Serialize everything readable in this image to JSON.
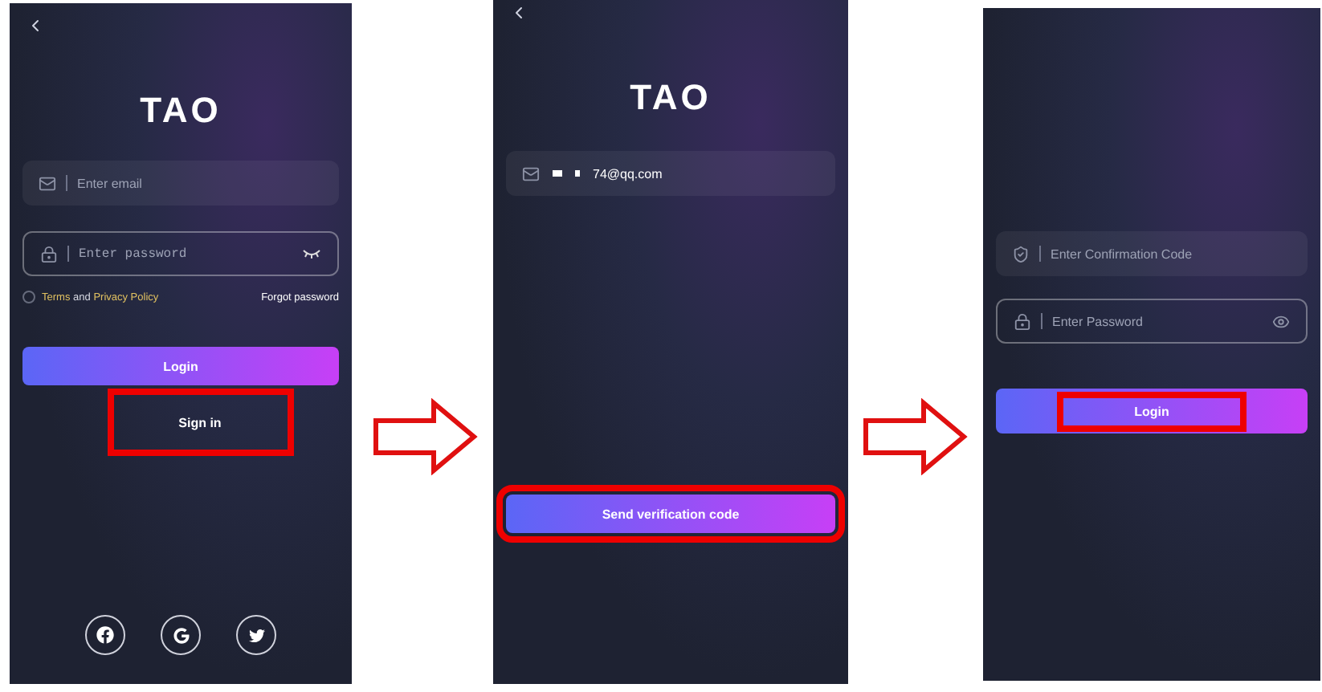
{
  "screens": [
    {
      "kind": "login",
      "logo": "TAO",
      "email_field": {
        "placeholder": "Enter email"
      },
      "password_field": {
        "placeholder": "Enter password"
      },
      "terms": {
        "checked": false,
        "parts": [
          {
            "kind": "link",
            "text": "Terms"
          },
          {
            "kind": "plain",
            "text": "and"
          },
          {
            "kind": "link",
            "text": "Privacy Policy"
          }
        ]
      },
      "forgot_link": "Forgot password",
      "login_button": {
        "label": "Login",
        "highlighted": false
      },
      "sign_in_button": {
        "label": "Sign in",
        "highlighted": true
      },
      "social": [
        {
          "kind": "facebook"
        },
        {
          "kind": "google"
        },
        {
          "kind": "twitter"
        }
      ]
    },
    {
      "kind": "verify",
      "logo": "TAO",
      "email_field": {
        "value": "74@qq.com",
        "masked": true
      },
      "send_button": {
        "label": "Send verification code",
        "highlighted": true
      }
    },
    {
      "kind": "password",
      "code_field": {
        "placeholder": "Enter Confirmation Code"
      },
      "password_field": {
        "placeholder": "Enter Password"
      },
      "login_button": {
        "label": "Login",
        "highlighted": true
      }
    }
  ]
}
